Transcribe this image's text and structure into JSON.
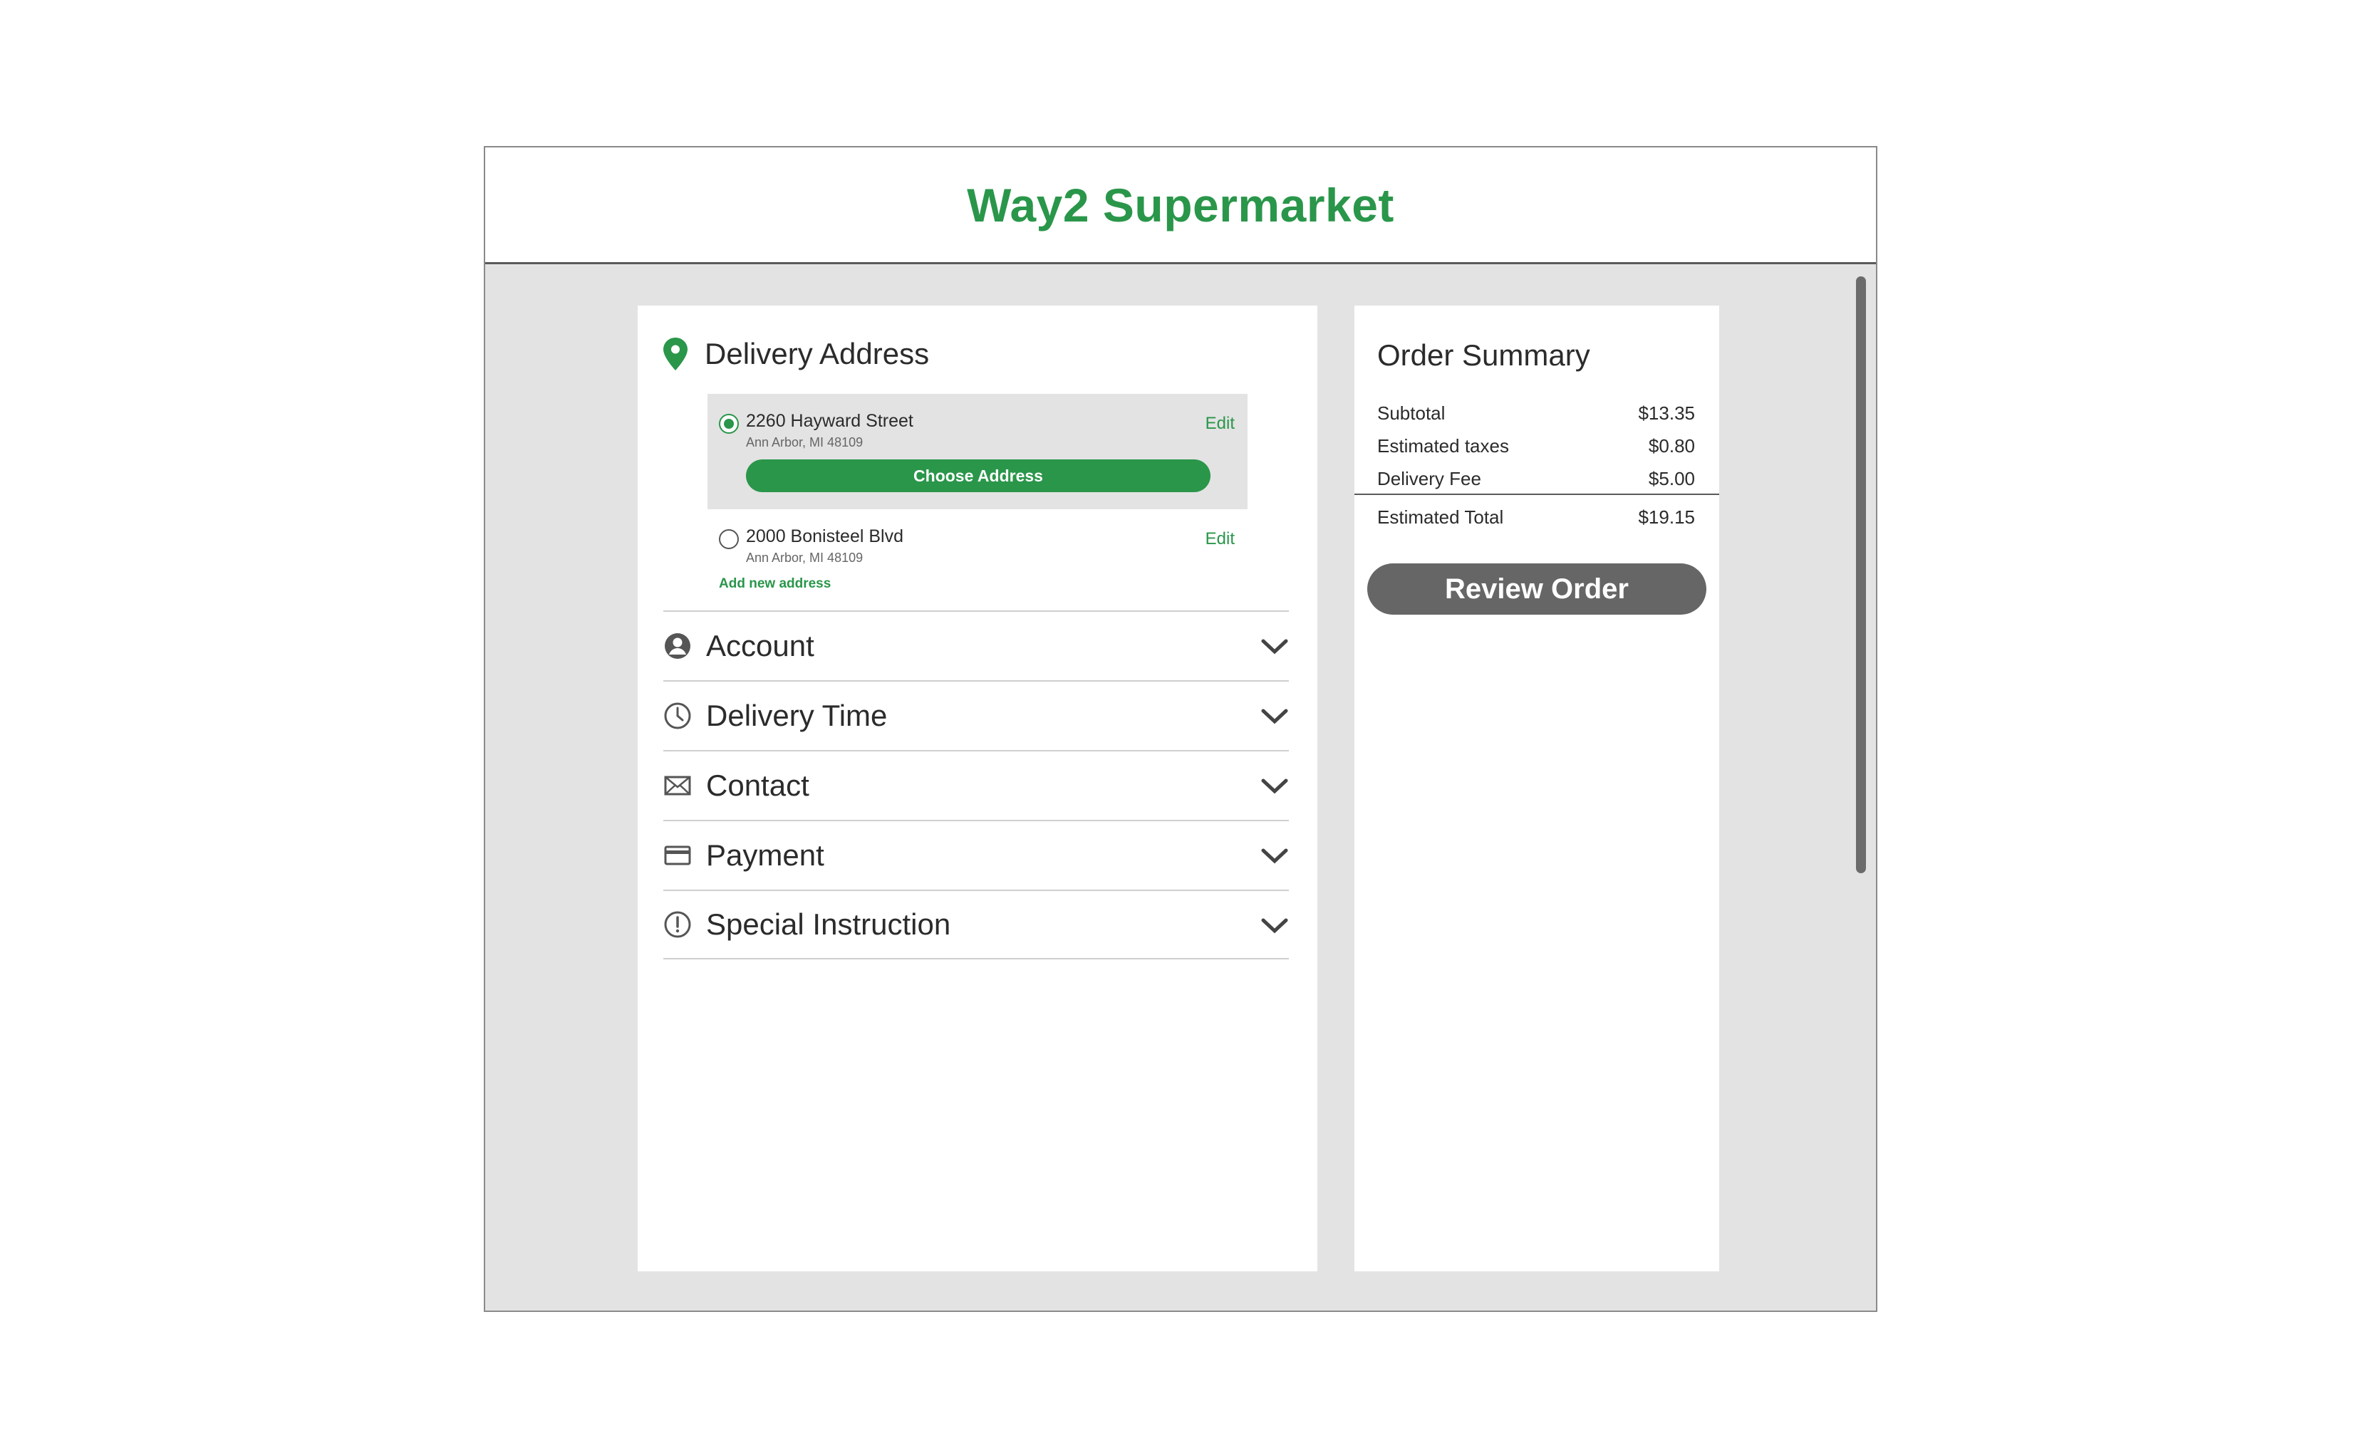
{
  "header": {
    "brand": "Way2 Supermarket"
  },
  "delivery": {
    "title": "Delivery Address",
    "addresses": [
      {
        "street": "2260 Hayward Street",
        "city": "Ann Arbor, MI 48109",
        "edit": "Edit",
        "selected": true
      },
      {
        "street": "2000 Bonisteel Blvd",
        "city": "Ann Arbor, MI 48109",
        "edit": "Edit",
        "selected": false
      }
    ],
    "choose_label": "Choose Address",
    "add_new": "Add new address"
  },
  "sections": [
    {
      "label": "Account",
      "icon": "account-icon"
    },
    {
      "label": "Delivery Time",
      "icon": "clock-icon"
    },
    {
      "label": "Contact",
      "icon": "envelope-icon"
    },
    {
      "label": "Payment",
      "icon": "credit-card-icon"
    },
    {
      "label": "Special Instruction",
      "icon": "exclamation-icon"
    }
  ],
  "summary": {
    "title": "Order Summary",
    "rows": [
      {
        "label": "Subtotal",
        "value": "$13.35"
      },
      {
        "label": "Estimated taxes",
        "value": "$0.80"
      },
      {
        "label": "Delivery Fee",
        "value": "$5.00"
      }
    ],
    "total": {
      "label": "Estimated Total",
      "value": "$19.15"
    },
    "review_label": "Review Order"
  },
  "colors": {
    "brand": "#2a964a",
    "button_gray": "#666666",
    "background": "#e3e3e3"
  }
}
